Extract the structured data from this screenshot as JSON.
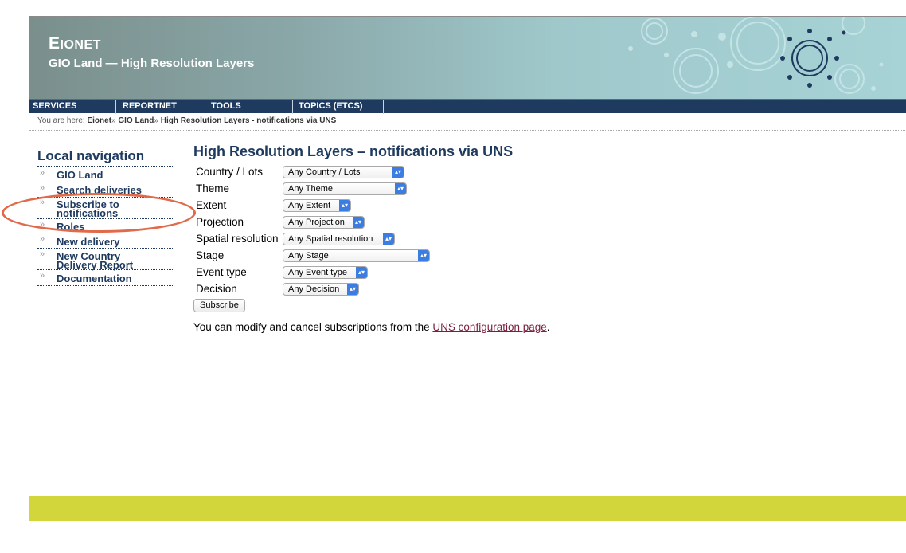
{
  "site": {
    "name_big": "E",
    "name_small": "IONET",
    "title": "GIO Land — High Resolution Layers"
  },
  "topnav": [
    "SERVICES",
    "REPORTNET",
    "TOOLS",
    "TOPICS (ETCS)"
  ],
  "breadcrumb": {
    "prefix": "You are here:",
    "items": [
      "Eionet",
      "GIO Land",
      "High Resolution Layers - notifications via UNS"
    ],
    "separator": "»"
  },
  "localnav": {
    "title": "Local navigation",
    "items": [
      {
        "label": "GIO Land"
      },
      {
        "label": "Search deliveries"
      },
      {
        "label_line1": "Subscribe to",
        "label_line2": "notifications"
      },
      {
        "label": "Roles"
      },
      {
        "label": "New delivery"
      },
      {
        "label_line1": "New Country",
        "label_line2": "Delivery Report"
      },
      {
        "label": "Documentation"
      }
    ],
    "arrow": "»"
  },
  "main": {
    "title": "High Resolution Layers – notifications via UNS",
    "fields": [
      {
        "label": "Country / Lots",
        "selected": "Any Country / Lots"
      },
      {
        "label": "Theme",
        "selected": "Any Theme"
      },
      {
        "label": "Extent",
        "selected": "Any Extent"
      },
      {
        "label": "Projection",
        "selected": "Any Projection"
      },
      {
        "label": "Spatial resolution",
        "selected": "Any Spatial resolution"
      },
      {
        "label": "Stage",
        "selected": "Any Stage"
      },
      {
        "label": "Event type",
        "selected": "Any Event type"
      },
      {
        "label": "Decision",
        "selected": "Any Decision"
      }
    ],
    "subscribe_label": "Subscribe",
    "info_prefix": "You can modify and cancel subscriptions from the ",
    "info_link": "UNS configuration page",
    "info_suffix": "."
  },
  "colors": {
    "nav_bg": "#1e3a5f",
    "footer": "#d2d63a",
    "highlight": "#e06a4a",
    "link": "#7a1f3d"
  },
  "icons": {
    "select_chevron": "chevron-updown-icon"
  }
}
